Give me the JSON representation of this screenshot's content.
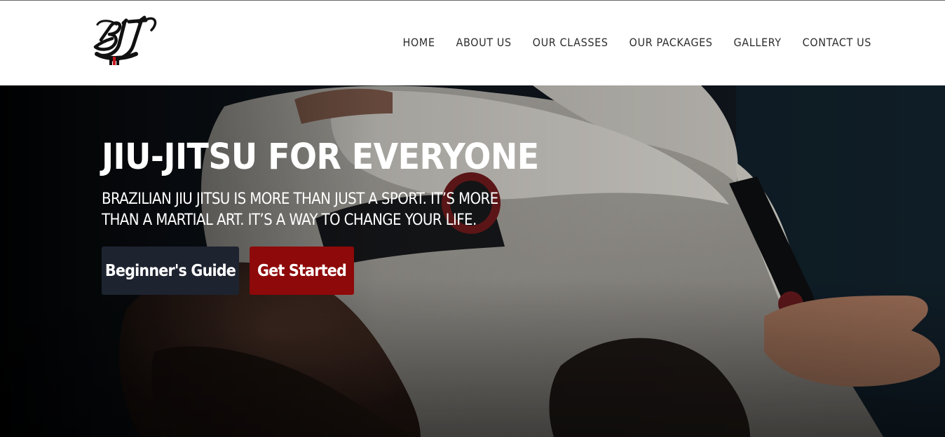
{
  "header": {
    "logo_text": "BJJ",
    "nav": [
      {
        "label": "HOME"
      },
      {
        "label": "ABOUT US"
      },
      {
        "label": "OUR CLASSES"
      },
      {
        "label": "OUR PACKAGES"
      },
      {
        "label": "GALLERY"
      },
      {
        "label": "CONTACT US"
      }
    ]
  },
  "hero": {
    "title": "JIU-JITSU FOR EVERYONE",
    "subtitle": "BRAZILIAN JIU JITSU IS MORE THAN JUST A SPORT. IT’S MORE THAN A MARTIAL ART. IT’S A WAY TO CHANGE YOUR LIFE.",
    "buttons": {
      "guide_label": "Beginner's Guide",
      "start_label": "Get Started"
    },
    "image": "jiu-jitsu-grappling-photo"
  },
  "colors": {
    "nav_text": "#2d2d2d",
    "hero_text": "#ffffff",
    "guide_button": "#1e2330",
    "start_button": "#8e0909",
    "logo_red": "#c4161c"
  }
}
